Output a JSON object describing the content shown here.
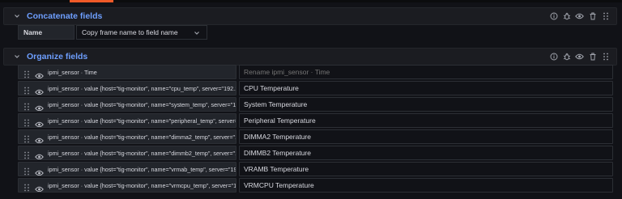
{
  "concatenate": {
    "title": "Concatenate fields",
    "name_label": "Name",
    "name_value": "Copy frame name to field name"
  },
  "organize": {
    "title": "Organize fields",
    "rows": [
      {
        "field": "ipmi_sensor · Time",
        "rename": "",
        "placeholder": "Rename ipmi_sensor · Time"
      },
      {
        "field": "ipmi_sensor · value {host=\"tig-monitor\", name=\"cpu_temp\", server=\"192.1...",
        "rename": "CPU Temperature",
        "placeholder": ""
      },
      {
        "field": "ipmi_sensor · value {host=\"tig-monitor\", name=\"system_temp\", server=\"19...",
        "rename": "System Temperature",
        "placeholder": ""
      },
      {
        "field": "ipmi_sensor · value {host=\"tig-monitor\", name=\"peripheral_temp\", server=...",
        "rename": "Peripheral Temperature",
        "placeholder": ""
      },
      {
        "field": "ipmi_sensor · value {host=\"tig-monitor\", name=\"dimma2_temp\", server=\"1...",
        "rename": "DIMMA2 Temperature",
        "placeholder": ""
      },
      {
        "field": "ipmi_sensor · value {host=\"tig-monitor\", name=\"dimmb2_temp\", server=\"1...",
        "rename": "DIMMB2 Temperature",
        "placeholder": ""
      },
      {
        "field": "ipmi_sensor · value {host=\"tig-monitor\", name=\"vrmab_temp\", server=\"19...",
        "rename": "VRAMB Temperature",
        "placeholder": ""
      },
      {
        "field": "ipmi_sensor · value {host=\"tig-monitor\", name=\"vrmcpu_temp\", server=\"19...",
        "rename": "VRMCPU Temperature",
        "placeholder": ""
      }
    ]
  },
  "icons": {
    "chevron": "chevron-down-icon",
    "info": "info-circle-icon",
    "debug": "bug-icon",
    "visibility": "eye-icon",
    "delete": "trash-icon",
    "drag": "drag-handle-icon"
  },
  "colors": {
    "accent": "#f05a28",
    "title_blue": "#6e9fff",
    "background": "#111217"
  }
}
